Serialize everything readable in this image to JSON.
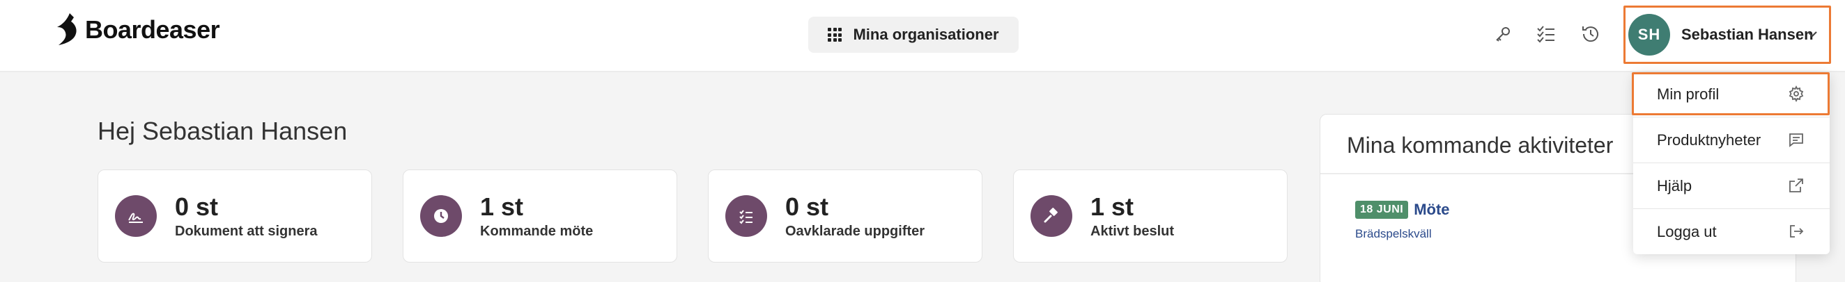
{
  "app": {
    "logo_text": "Boardeaser"
  },
  "header": {
    "org_button_label": "Mina organisationer",
    "icons": [
      "key-icon",
      "checklist-icon",
      "history-icon"
    ],
    "user": {
      "initials": "SH",
      "name": "Sebastian Hansen",
      "avatar_color": "#3f7d72"
    }
  },
  "main": {
    "greeting": "Hej Sebastian Hansen",
    "stats": [
      {
        "value": "0 st",
        "label": "Dokument att signera",
        "icon": "signature-icon"
      },
      {
        "value": "1 st",
        "label": "Kommande möte",
        "icon": "clock-icon"
      },
      {
        "value": "0 st",
        "label": "Oavklarade uppgifter",
        "icon": "task-list-icon"
      },
      {
        "value": "1 st",
        "label": "Aktivt beslut",
        "icon": "gavel-icon"
      }
    ],
    "activities": {
      "title": "Mina kommande aktiviteter",
      "items": [
        {
          "date": "18 JUNI",
          "type": "Möte",
          "name": "Brädspelskväll"
        }
      ]
    }
  },
  "user_menu": {
    "items": [
      {
        "label": "Min profil",
        "icon": "gear-icon"
      },
      {
        "label": "Produktnyheter",
        "icon": "message-icon"
      },
      {
        "label": "Hjälp",
        "icon": "external-link-icon"
      },
      {
        "label": "Logga ut",
        "icon": "logout-icon"
      }
    ]
  },
  "colors": {
    "accent_highlight": "#ec7a34",
    "stat_icon_bg": "#6e4a6a",
    "badge_green": "#4f8f6a",
    "link_blue": "#2b4a8b"
  }
}
